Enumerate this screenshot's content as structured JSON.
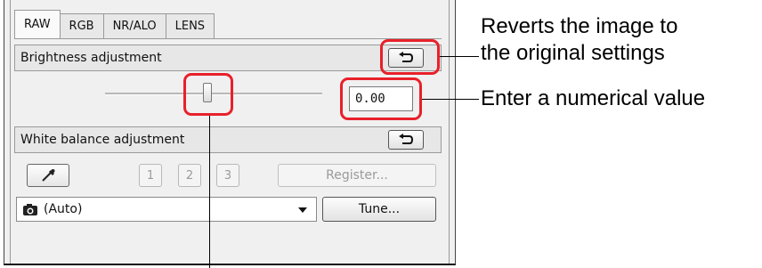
{
  "tabs": [
    "RAW",
    "RGB",
    "NR/ALO",
    "LENS"
  ],
  "active_tab": "RAW",
  "brightness": {
    "title": "Brightness adjustment",
    "value": "0.00",
    "reset_icon": "reset-arrow-icon"
  },
  "white_balance": {
    "title": "White balance adjustment",
    "reset_icon": "reset-arrow-icon",
    "eyedropper_icon": "eyedropper-icon",
    "presets": [
      "1",
      "2",
      "3"
    ],
    "register_label": "Register...",
    "selected": "(Auto)",
    "camera_icon": "camera-icon",
    "tune_label": "Tune..."
  },
  "annotations": {
    "reset_line1": "Reverts the image to",
    "reset_line2": "the original settings",
    "numeric": "Enter a numerical value"
  },
  "colors": {
    "highlight": "#e8202a",
    "panel": "#f0f0f0"
  }
}
